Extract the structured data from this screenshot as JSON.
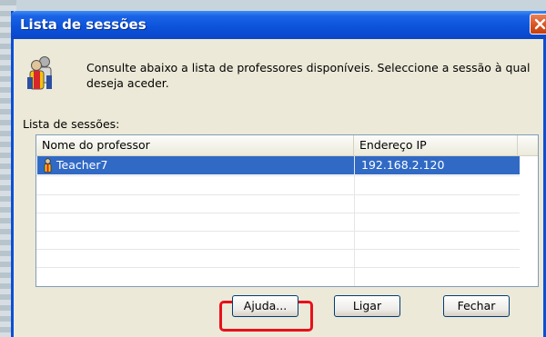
{
  "window": {
    "title": "Lista de sessões",
    "close_label": "Fechar janela"
  },
  "intro": {
    "text": "Consulte abaixo a lista de professores disponíveis. Seleccione a sessão à qual deseja aceder."
  },
  "list": {
    "label": "Lista de sessões:",
    "columns": [
      "Nome do professor",
      "Endereço IP"
    ],
    "rows": [
      {
        "name": "Teacher7",
        "ip": "192.168.2.120",
        "selected": true
      }
    ]
  },
  "buttons": {
    "help": "Ajuda...",
    "connect": "Ligar",
    "close": "Fechar"
  },
  "colors": {
    "selection": "#316ac5",
    "highlight_frame": "#e8101a",
    "title_bar": "#0c54da"
  },
  "icons": [
    "people-icon",
    "user-icon",
    "close-icon"
  ]
}
